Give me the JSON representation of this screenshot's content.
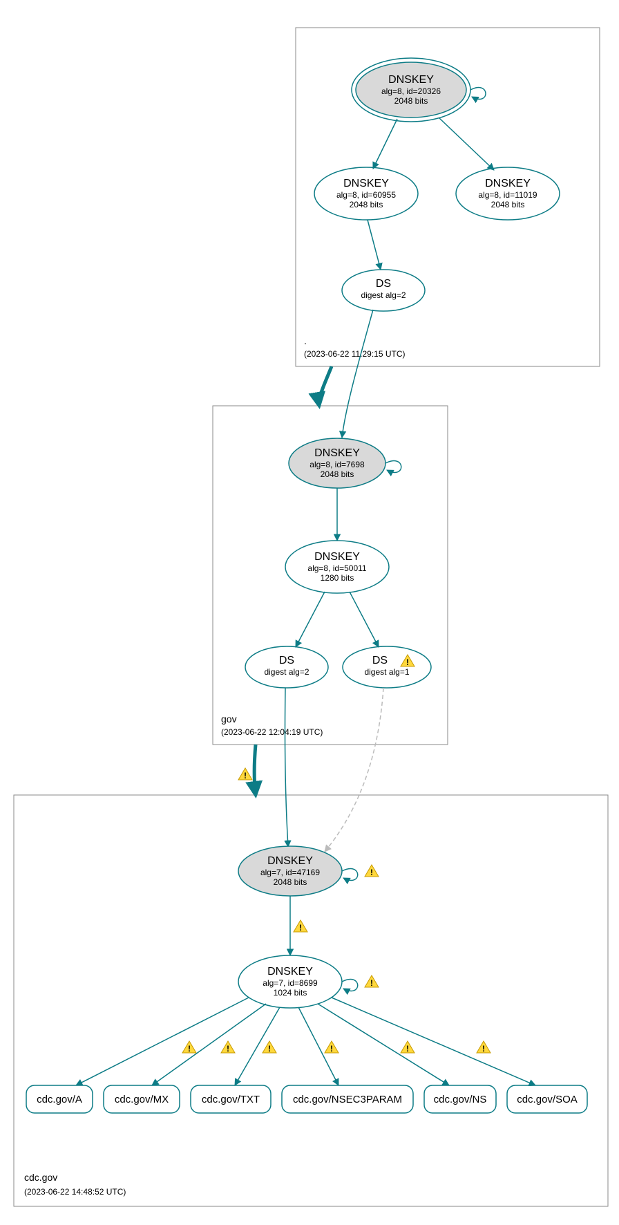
{
  "colors": {
    "primary": "#0d7c86",
    "node_grey": "#d9d9d9",
    "edge_grey": "#bbbbbb"
  },
  "zones": {
    "root": {
      "label": ".",
      "timestamp": "(2023-06-22 11:29:15 UTC)"
    },
    "gov": {
      "label": "gov",
      "timestamp": "(2023-06-22 12:04:19 UTC)"
    },
    "cdc": {
      "label": "cdc.gov",
      "timestamp": "(2023-06-22 14:48:52 UTC)"
    }
  },
  "nodes": {
    "root_ksk": {
      "title": "DNSKEY",
      "line1": "alg=8, id=20326",
      "line2": "2048 bits"
    },
    "root_zsk": {
      "title": "DNSKEY",
      "line1": "alg=8, id=60955",
      "line2": "2048 bits"
    },
    "root_key2": {
      "title": "DNSKEY",
      "line1": "alg=8, id=11019",
      "line2": "2048 bits"
    },
    "root_ds": {
      "title": "DS",
      "line1": "digest alg=2"
    },
    "gov_ksk": {
      "title": "DNSKEY",
      "line1": "alg=8, id=7698",
      "line2": "2048 bits"
    },
    "gov_zsk": {
      "title": "DNSKEY",
      "line1": "alg=8, id=50011",
      "line2": "1280 bits"
    },
    "gov_ds1": {
      "title": "DS",
      "line1": "digest alg=2"
    },
    "gov_ds2": {
      "title": "DS",
      "line1": "digest alg=1"
    },
    "cdc_ksk": {
      "title": "DNSKEY",
      "line1": "alg=7, id=47169",
      "line2": "2048 bits"
    },
    "cdc_zsk": {
      "title": "DNSKEY",
      "line1": "alg=7, id=8699",
      "line2": "1024 bits"
    }
  },
  "rr": {
    "a": "cdc.gov/A",
    "mx": "cdc.gov/MX",
    "txt": "cdc.gov/TXT",
    "nsec3": "cdc.gov/NSEC3PARAM",
    "ns": "cdc.gov/NS",
    "soa": "cdc.gov/SOA"
  },
  "warning_glyph": "!"
}
